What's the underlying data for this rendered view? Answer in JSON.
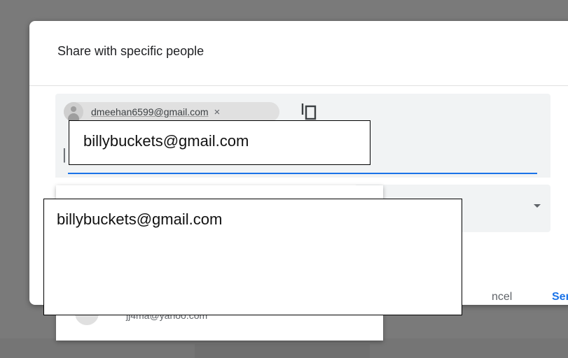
{
  "dialog": {
    "title": "Share with specific people"
  },
  "recipients": {
    "chip_email": "dmeehan6599@gmail.com",
    "chip_close_glyph": "×",
    "caret_glyph": "|",
    "copy_icon": "copy-icon"
  },
  "overlay_input": {
    "text": "billybuckets@gmail.com"
  },
  "overlay_popup": {
    "text": "billybuckets@gmail.com"
  },
  "suggestions": {
    "items": [
      {
        "email": "jj4ma@yahoo.com"
      }
    ]
  },
  "actions": {
    "cancel_label": "ncel",
    "send_label": "Send"
  },
  "colors": {
    "accent": "#1a73e8",
    "field_bg": "#f1f3f4",
    "backdrop": "#7a7a7a"
  }
}
